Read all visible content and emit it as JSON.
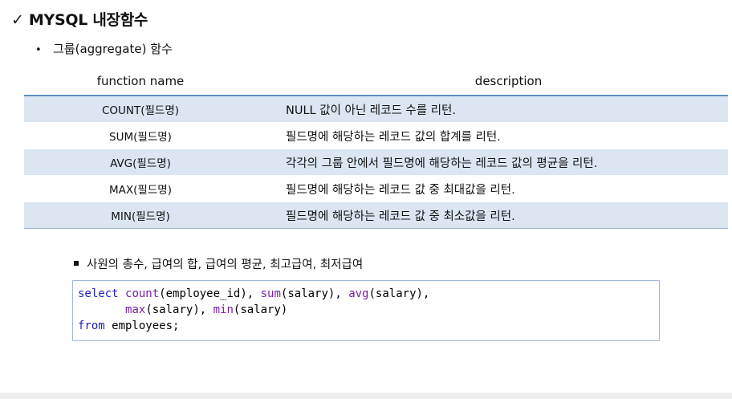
{
  "header": {
    "title": "✓ MYSQL 내장함수",
    "subtitle_bullet": "•",
    "subtitle": "그룹(aggregate) 함수"
  },
  "table": {
    "columns": [
      "function name",
      "description"
    ],
    "rows": [
      {
        "function": "COUNT(필드명)",
        "description": "NULL 값이 아닌 레코드 수를 리턴."
      },
      {
        "function": "SUM(필드명)",
        "description": "필드명에 해당하는 레코드 값의 합계를 리턴."
      },
      {
        "function": "AVG(필드명)",
        "description": "각각의 그룹 안에서 필드명에 해당하는 레코드 값의 평균을 리턴."
      },
      {
        "function": "MAX(필드명)",
        "description": "필드명에 해당하는 레코드 값 중 최대값을 리턴."
      },
      {
        "function": "MIN(필드명)",
        "description": "필드명에 해당하는 레코드 값 중 최소값을 리턴."
      }
    ],
    "row_shade_color": "#dbe6f2",
    "header_rule_color": "#5d8fc3"
  },
  "note": {
    "text": "사원의 총수, 급여의 합, 급여의 평균, 최고급여, 최저급여"
  },
  "code": {
    "tokens": {
      "select": "select",
      "count": "count",
      "arg1": "(employee_id), ",
      "sum": "sum",
      "arg2": "(salary), ",
      "avg": "avg",
      "arg3": "(salary),",
      "indent": "       ",
      "max": "max",
      "arg4": "(salary), ",
      "min": "min",
      "arg5": "(salary)",
      "from": "from",
      "table": " employees;"
    },
    "keyword_color": "#2020c0",
    "function_color": "#7a1ea8"
  }
}
